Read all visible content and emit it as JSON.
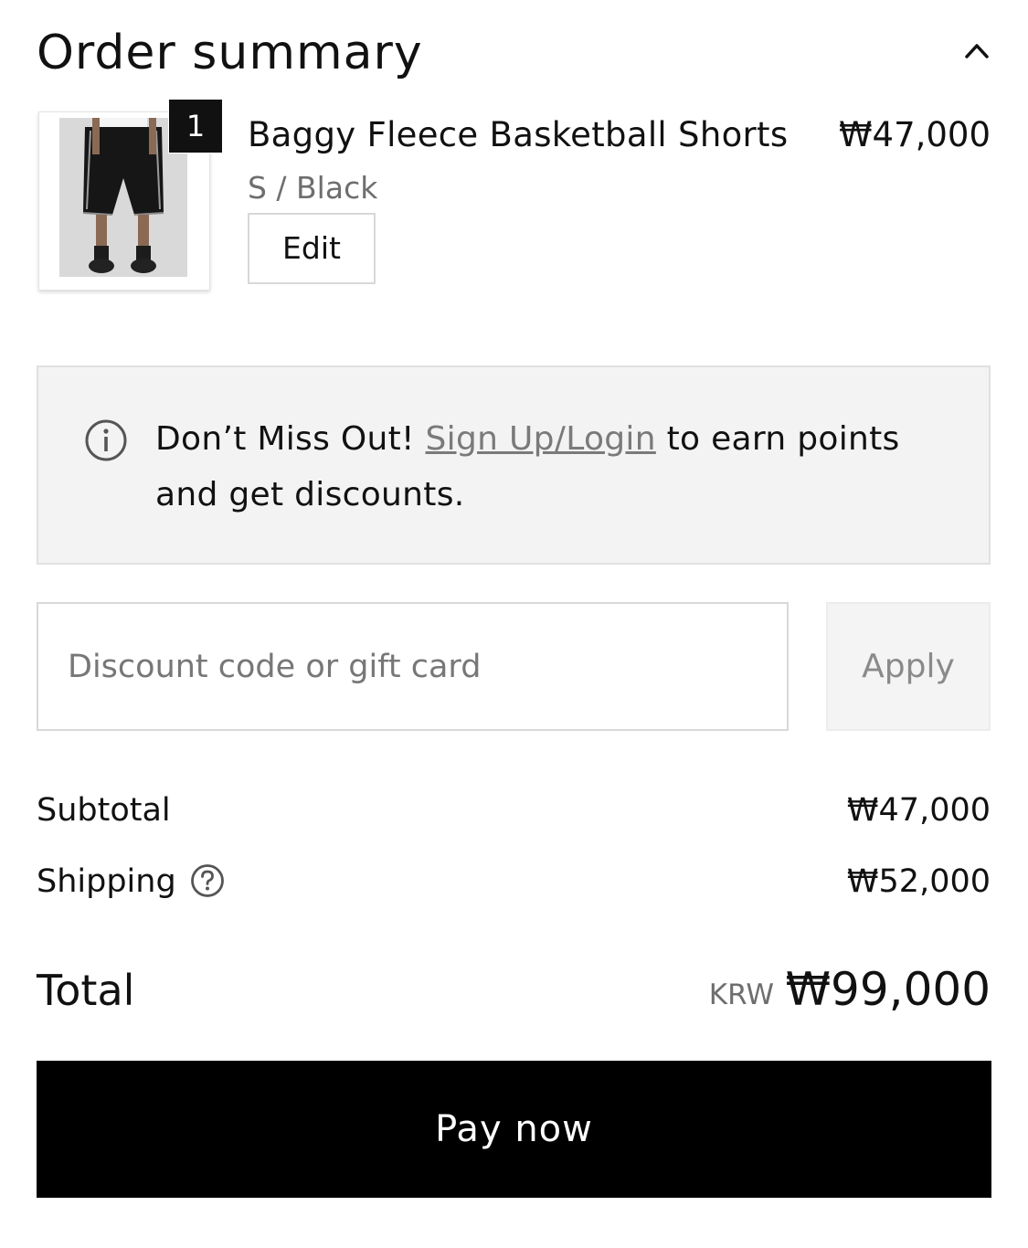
{
  "header": {
    "title": "Order summary",
    "toggle_icon": "chevron-up-icon"
  },
  "item": {
    "quantity": "1",
    "name": "Baggy Fleece Basketball Shorts",
    "variant": "S / Black",
    "edit_label": "Edit",
    "price": "₩47,000"
  },
  "notice": {
    "icon": "info-icon",
    "prefix": "Don’t Miss Out! ",
    "link": "Sign Up/Login",
    "suffix": " to earn points and get discounts."
  },
  "discount": {
    "placeholder": "Discount code or gift card",
    "value": "",
    "apply_label": "Apply"
  },
  "summary": {
    "subtotal_label": "Subtotal",
    "subtotal_value": "₩47,000",
    "shipping_label": "Shipping",
    "shipping_icon": "question-circle-icon",
    "shipping_value": "₩52,000",
    "total_label": "Total",
    "total_currency": "KRW",
    "total_value": "₩99,000"
  },
  "pay_button": {
    "label": "Pay now",
    "color": "#000000"
  }
}
